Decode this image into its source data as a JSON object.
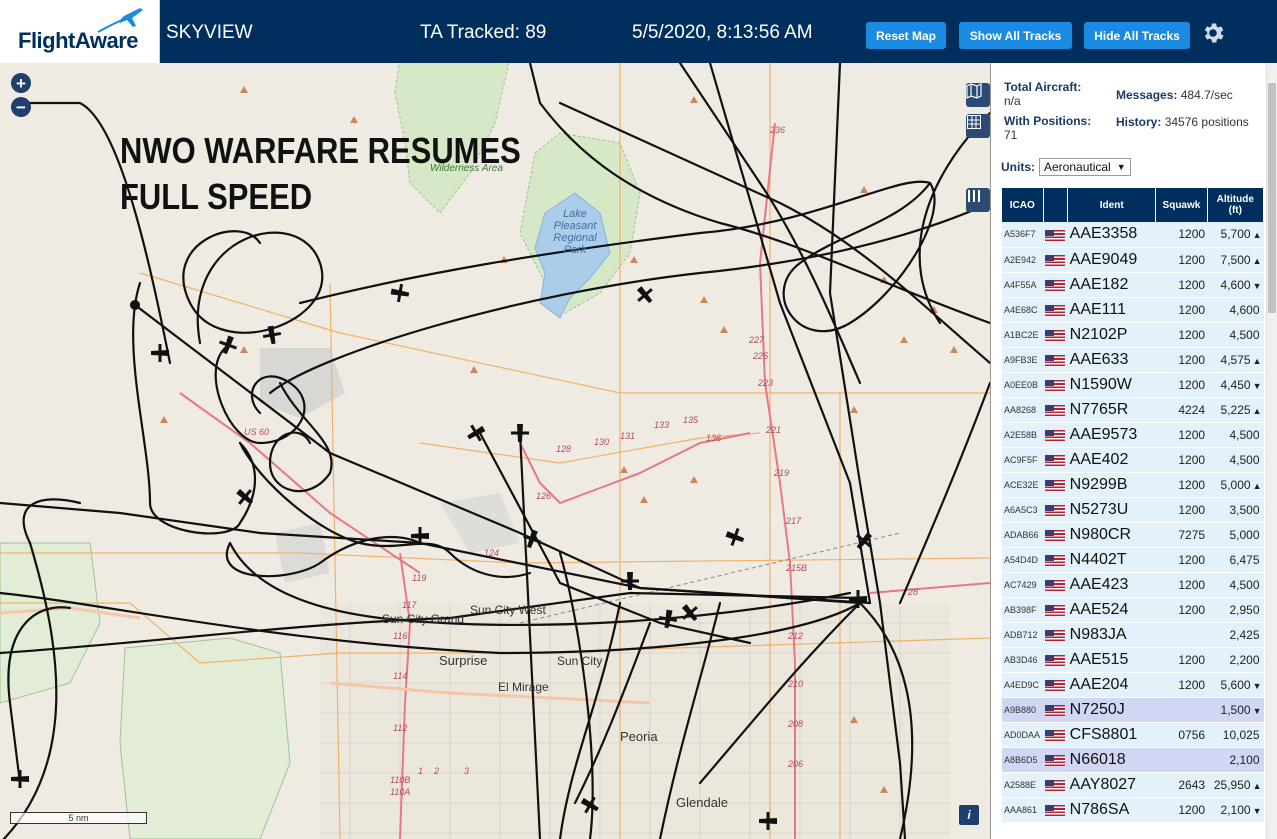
{
  "header": {
    "logo": "FlightAware",
    "app_title": "SKYVIEW",
    "ta_tracked": "TA Tracked: 89",
    "clock": "5/5/2020, 8:13:56 AM",
    "buttons": {
      "reset": "Reset Map",
      "show": "Show All Tracks",
      "hide": "Hide All Tracks"
    },
    "accent_color": "#1a8be0",
    "bar_color": "#002f5d"
  },
  "map": {
    "overlay_title_line1": "NWO WARFARE RESUMES",
    "overlay_title_line2": "FULL SPEED",
    "zoom_in": "+",
    "zoom_out": "−",
    "scale": "5 nm",
    "info": "i",
    "labels": {
      "wilderness": "Wilderness Area",
      "lake": "Lake Pleasant Regional Park",
      "sun_city_grand": "Sun City Grand",
      "sun_city_west": "Sun City West",
      "surprise": "Surprise",
      "sun_city": "Sun City",
      "el_mirage": "El Mirage",
      "peoria": "Peoria",
      "glendale": "Glendale",
      "us60": "US 60"
    },
    "road_numbers": [
      "236",
      "227",
      "225",
      "223",
      "221",
      "219",
      "217",
      "215B",
      "212",
      "210",
      "208",
      "206",
      "131",
      "133",
      "135",
      "136",
      "130",
      "128",
      "126",
      "124",
      "119",
      "117",
      "116",
      "114",
      "112",
      "110B",
      "110A",
      "1",
      "2",
      "3",
      "28"
    ]
  },
  "sidebar": {
    "total_aircraft_label": "Total Aircraft:",
    "total_aircraft_value": "n/a",
    "with_positions_label": "With Positions:",
    "with_positions_value": "71",
    "messages_label": "Messages:",
    "messages_value": "484.7/sec",
    "history_label": "History:",
    "history_value": "34576 positions",
    "units_label": "Units:",
    "units_value": "Aeronautical",
    "columns": [
      "ICAO",
      "",
      "Ident",
      "Squawk",
      "Altitude (ft)"
    ],
    "rows": [
      {
        "icao": "A536F7",
        "ident": "AAE3358",
        "squawk": "1200",
        "alt": "5,700",
        "trend": "▲",
        "sel": false
      },
      {
        "icao": "A2E942",
        "ident": "AAE9049",
        "squawk": "1200",
        "alt": "7,500",
        "trend": "▲",
        "sel": false
      },
      {
        "icao": "A4F55A",
        "ident": "AAE182",
        "squawk": "1200",
        "alt": "4,600",
        "trend": "▼",
        "sel": false
      },
      {
        "icao": "A4E68C",
        "ident": "AAE111",
        "squawk": "1200",
        "alt": "4,600",
        "trend": "",
        "sel": false
      },
      {
        "icao": "A1BC2E",
        "ident": "N2102P",
        "squawk": "1200",
        "alt": "4,500",
        "trend": "",
        "sel": false
      },
      {
        "icao": "A9FB3E",
        "ident": "AAE633",
        "squawk": "1200",
        "alt": "4,575",
        "trend": "▲",
        "sel": false
      },
      {
        "icao": "A0EE0B",
        "ident": "N1590W",
        "squawk": "1200",
        "alt": "4,450",
        "trend": "▼",
        "sel": false
      },
      {
        "icao": "AA8268",
        "ident": "N7765R",
        "squawk": "4224",
        "alt": "5,225",
        "trend": "▲",
        "sel": false
      },
      {
        "icao": "A2E58B",
        "ident": "AAE9573",
        "squawk": "1200",
        "alt": "4,500",
        "trend": "",
        "sel": false
      },
      {
        "icao": "AC9F5F",
        "ident": "AAE402",
        "squawk": "1200",
        "alt": "4,500",
        "trend": "",
        "sel": false
      },
      {
        "icao": "ACE32E",
        "ident": "N9299B",
        "squawk": "1200",
        "alt": "5,000",
        "trend": "▲",
        "sel": false
      },
      {
        "icao": "A6A5C3",
        "ident": "N5273U",
        "squawk": "1200",
        "alt": "3,500",
        "trend": "",
        "sel": false
      },
      {
        "icao": "ADAB66",
        "ident": "N980CR",
        "squawk": "7275",
        "alt": "5,000",
        "trend": "",
        "sel": false
      },
      {
        "icao": "A54D4D",
        "ident": "N4402T",
        "squawk": "1200",
        "alt": "6,475",
        "trend": "",
        "sel": false
      },
      {
        "icao": "AC7429",
        "ident": "AAE423",
        "squawk": "1200",
        "alt": "4,500",
        "trend": "",
        "sel": false
      },
      {
        "icao": "AB398F",
        "ident": "AAE524",
        "squawk": "1200",
        "alt": "2,950",
        "trend": "",
        "sel": false
      },
      {
        "icao": "ADB712",
        "ident": "N983JA",
        "squawk": "",
        "alt": "2,425",
        "trend": "",
        "sel": false
      },
      {
        "icao": "AB3D46",
        "ident": "AAE515",
        "squawk": "1200",
        "alt": "2,200",
        "trend": "",
        "sel": false
      },
      {
        "icao": "A4ED9C",
        "ident": "AAE204",
        "squawk": "1200",
        "alt": "5,600",
        "trend": "▼",
        "sel": false
      },
      {
        "icao": "A9B880",
        "ident": "N7250J",
        "squawk": "",
        "alt": "1,500",
        "trend": "▼",
        "sel": true
      },
      {
        "icao": "AD0DAA",
        "ident": "CFS8801",
        "squawk": "0756",
        "alt": "10,025",
        "trend": "",
        "sel": false
      },
      {
        "icao": "A8B6D5",
        "ident": "N66018",
        "squawk": "",
        "alt": "2,100",
        "trend": "",
        "sel": true
      },
      {
        "icao": "A2588E",
        "ident": "AAY8027",
        "squawk": "2643",
        "alt": "25,950",
        "trend": "▲",
        "sel": false
      },
      {
        "icao": "AAA861",
        "ident": "N786SA",
        "squawk": "1200",
        "alt": "2,100",
        "trend": "▼",
        "sel": false
      }
    ]
  }
}
